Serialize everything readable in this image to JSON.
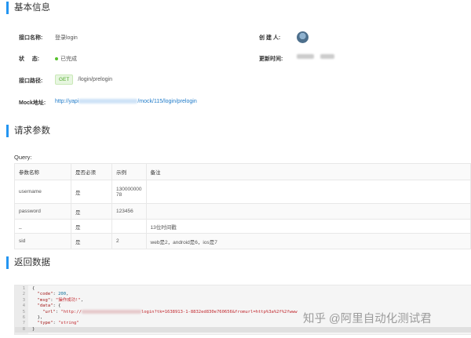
{
  "sections": {
    "basic_info": "基本信息",
    "request_params": "请求参数",
    "response_data": "返回数据"
  },
  "info": {
    "name_label": "接口名称:",
    "name_value": "登录login",
    "creator_label": "创 建 人:",
    "status_label": "状     态:",
    "status_value": "已完成",
    "updated_label": "更新时间:",
    "path_label": "接口路径:",
    "method": "GET",
    "path_value": "/login/prelogin",
    "mock_label": "Mock地址:",
    "mock_prefix": "http://yapi",
    "mock_suffix": "/mock/115/login/prelogin"
  },
  "query": {
    "label": "Query:",
    "headers": [
      "参数名称",
      "是否必须",
      "示例",
      "备注"
    ],
    "rows": [
      {
        "name": "username",
        "required": "是",
        "example_line1": "130000000",
        "example_line2": "78",
        "note": ""
      },
      {
        "name": "password",
        "required": "是",
        "example_line1": "123456",
        "example_line2": "",
        "note": ""
      },
      {
        "name": "_",
        "required": "是",
        "example_line1": "",
        "example_line2": "",
        "note": "13位时间戳"
      },
      {
        "name": "sid",
        "required": "是",
        "example_line1": "2",
        "example_line2": "",
        "note": "web是2，android是6，ios是7"
      }
    ]
  },
  "code": {
    "line_numbers": [
      "1",
      "2",
      "3",
      "4",
      "5",
      "6",
      "7",
      "8"
    ],
    "l1": "{",
    "l2_key": "\"code\"",
    "l2_val": "200",
    "l3_key": "\"msg\"",
    "l3_val": "\"操作成功!\"",
    "l4_key": "\"data\"",
    "l4_rest": ": {",
    "l5_key": "\"url\"",
    "l5_val_start": "\"http://",
    "l5_val_end": "login?tk=1638913-1-8832ed830e760656&fromurl=http%3a%2f%2fwww",
    "l6": "},",
    "l7_key": "\"type\"",
    "l7_val": "\"string\"",
    "l8": "}"
  },
  "watermark": "知乎 @阿里自动化测试君"
}
